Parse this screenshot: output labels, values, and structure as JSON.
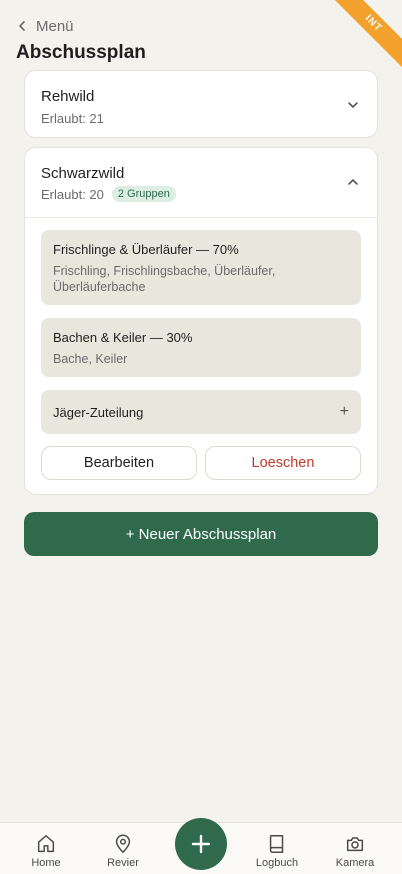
{
  "env_badge": "INT",
  "header": {
    "back_label": "Menü",
    "title": "Abschussplan"
  },
  "plans": [
    {
      "title": "Rehwild",
      "allowed": "Erlaubt: 21",
      "expanded": false
    },
    {
      "title": "Schwarzwild",
      "allowed": "Erlaubt: 20",
      "badge": "2 Gruppen",
      "expanded": true,
      "groups": [
        {
          "title": "Frischlinge & Überläufer — 70%",
          "members": "Frischling, Frischlingsbache, Überläufer, Überläuferbache"
        },
        {
          "title": "Bachen & Keiler — 30%",
          "members": "Bache, Keiler"
        }
      ],
      "assignment_label": "Jäger-Zuteilung",
      "edit_label": "Bearbeiten",
      "delete_label": "Loeschen"
    }
  ],
  "new_plan_label": "+ Neuer Abschussplan",
  "nav": {
    "home": "Home",
    "revier": "Revier",
    "logbuch": "Logbuch",
    "kamera": "Kamera"
  },
  "colors": {
    "primary": "#2f6a4d",
    "danger": "#c0392b",
    "ribbon": "#f2a12d",
    "background": "#f4f2ed"
  }
}
